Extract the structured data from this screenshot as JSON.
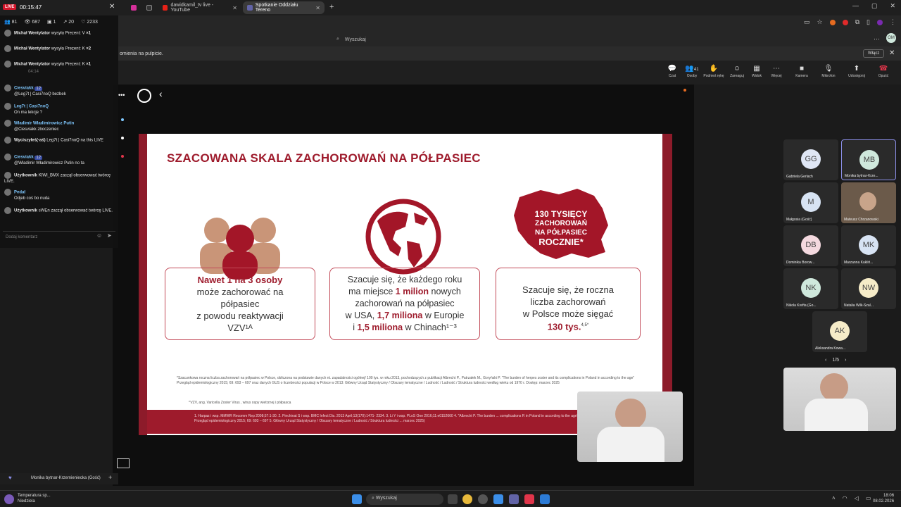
{
  "overlay_top": {
    "live": "LIVE",
    "timer": "00:15:47",
    "viewers": "81",
    "views": "687",
    "likes": "2233",
    "count20": "20",
    "count1": "1"
  },
  "tabs": [
    {
      "label": "dawidkamil_tv live - YouTube"
    },
    {
      "label": "Spotkanie Oddziału Tereno"
    }
  ],
  "search_placeholder": "Wyszukaj",
  "notification": {
    "text": "omienia na pulpicie.",
    "button": "Włącz"
  },
  "meeting_toolbar": [
    {
      "label": "Czat",
      "icon": "chat-icon"
    },
    {
      "label": "Osoby",
      "icon": "people-icon",
      "badge": "41"
    },
    {
      "label": "Podnieś rękę",
      "icon": "hand-icon"
    },
    {
      "label": "Zareaguj",
      "icon": "smile-icon"
    },
    {
      "label": "Widok",
      "icon": "grid-icon"
    },
    {
      "label": "Więcej",
      "icon": "more-icon"
    },
    {
      "label": "Kamera",
      "icon": "camera-icon"
    },
    {
      "label": "Mikrofon",
      "icon": "mic-off-icon"
    },
    {
      "label": "Udostępnij",
      "icon": "share-icon"
    },
    {
      "label": "Opuść",
      "icon": "phone-leave-icon"
    }
  ],
  "slide": {
    "title": "SZACOWANA SKALA ZACHOROWAŃ NA PÓŁPASIEC",
    "box1": {
      "l1": "Nawet 1 na 3 osoby",
      "l2": "może zachorować na",
      "l3": "półpasiec",
      "l4": "z powodu reaktywacji",
      "l5": "VZV¹ᴬ"
    },
    "box2": {
      "l1": "Szacuje się, że każdego roku",
      "l2a": "ma miejsce ",
      "l2b": "1 milion",
      "l2c": " nowych",
      "l3": "zachorowań na półpasiec",
      "l4a": "w USA, ",
      "l4b": "1,7 miliona",
      "l4c": " w Europie",
      "l5a": "i ",
      "l5b": "1,5 miliona",
      "l5c": " w Chinach¹⁻³"
    },
    "box3": {
      "l1": "Szacuje się, że roczna",
      "l2": "liczba zachorowań",
      "l3": "w Polsce może sięgać",
      "l4": "130 tys.",
      "sup": "4,5*"
    },
    "poland_text": {
      "l1": "130 TYSIĘCY",
      "l2": "ZACHOROWAŃ",
      "l3": "NA PÓŁPASIEC",
      "l4": "ROCZNIE*"
    },
    "footnote1": "*Szacunkowa roczna liczba zachorowań na półpasiec w Polsce, obliczona na podstawie danych nt. zapadalności ogólnej/ 100 tys. w roku 2013, pochodzących z publikacji Albrecht P., Patrzałek M., Goryński P. \"The burden of herpes zoster and its complications in Poland in according to the age\" Przegląd epidemiologiczny 2015; 69: 693 – 697 oraz danych GUS o liczebności populacji w Polsce w 2013: Główny Urząd Statystyczny / Obszary tematyczne / Ludność / Ludność / Struktura ludności według wieku od 1970 r. Dostęp: marzec 2025",
    "footnote2": "^VZV, ang. Varicella Zoster Virus , wirus ospy wietrznej i półpasca",
    "footnote3": "1. Harpaz i wsp. MMWR Recomm Rep 2008;57:1-30. 2. Pinchinat S i wsp. BMC Infect Dis. 2013 April;13(170):1471- 2334. 3. Li Y i wsp. PLoS One 2016;11:e0152660 4. \"Albrecht P. The burden ... complications R in Poland in according to the age\" Przegląd epidemiologiczny 2015; 69: 693 – 697 5. Główny Urząd Statystyczny / Obszary tematyczne / Ludność / Struktura ludności ... marzec 2025)"
  },
  "chat": [
    {
      "user": "Michał Wentylator",
      "text": "wysyła Prezent: V",
      "count": "×1"
    },
    {
      "user": "Michał Wentylator",
      "text": "wysyła Prezent: K",
      "count": "×2"
    },
    {
      "user": "Michał Wentylator",
      "text": "wysyła Prezent: K",
      "count": "×1"
    },
    {
      "user": "Ciesviakk",
      "badge": "12",
      "text": "@Leg7t | Casi7noQ bezbek"
    },
    {
      "user": "Leg7t | Casi7noQ",
      "text": "On ma lekcje ?"
    },
    {
      "user": "Władimir Władimirowicz Putin",
      "text": "@Ciesviakk zboczeniec"
    },
    {
      "user": "Wyciszyłeś(-aś)",
      "text": "Leg7t | Casi7noQ na this LIVE"
    },
    {
      "user": "Ciesviakk",
      "badge": "12",
      "text": "@Władimir Władimirowicz Putin no ta"
    },
    {
      "user": "Użytkownik",
      "text": "KIWI_BMX zaczął obserwować twórcę LIVE."
    },
    {
      "user": "Pedał",
      "text": "Odjeb coś bo nuda"
    },
    {
      "user": "Użytkownik",
      "text": "sWEn zaczął obserwować twórcę LIVE."
    }
  ],
  "chat_input_placeholder": "Dodaj komentarz",
  "notif_snippet": "Rzymj rękę na pulsie. Włącz powiadomienia",
  "snippet_time": "04:14",
  "participants": [
    {
      "initials": "GG",
      "name": "Gabriela Gerlach",
      "color": "#dfe6f5"
    },
    {
      "initials": "MB",
      "name": "Monika bytnar-Krze...",
      "color": "#cfe8dc"
    },
    {
      "initials": "M",
      "name": "Małgosia (Gość)",
      "color": "#d7e3f3"
    },
    {
      "initials": "",
      "name": "Mateusz Chrzanowski",
      "color": "#6b5a4a"
    },
    {
      "initials": "DB",
      "name": "Dominika Borow...",
      "color": "#f4d9df"
    },
    {
      "initials": "MK",
      "name": "Marzanna Kukliń...",
      "color": "#d7e3f3"
    },
    {
      "initials": "NK",
      "name": "Nikola Krefta (Go...",
      "color": "#cfe8dc"
    },
    {
      "initials": "NW",
      "name": "Natalia Wilk-Szal...",
      "color": "#f6ecc8"
    },
    {
      "initials": "AK",
      "name": "Aleksandra Kowa...",
      "color": "#f6ecc8"
    }
  ],
  "pagination": "1/5",
  "speaker_name": "Monika bytnar-Krzemieniecka (Gość)",
  "taskbar": {
    "weather": "Temperatura sp...",
    "weather2": "Niedziela",
    "search": "Wyszukaj",
    "time": "18:06",
    "date": "08.02.2026"
  }
}
